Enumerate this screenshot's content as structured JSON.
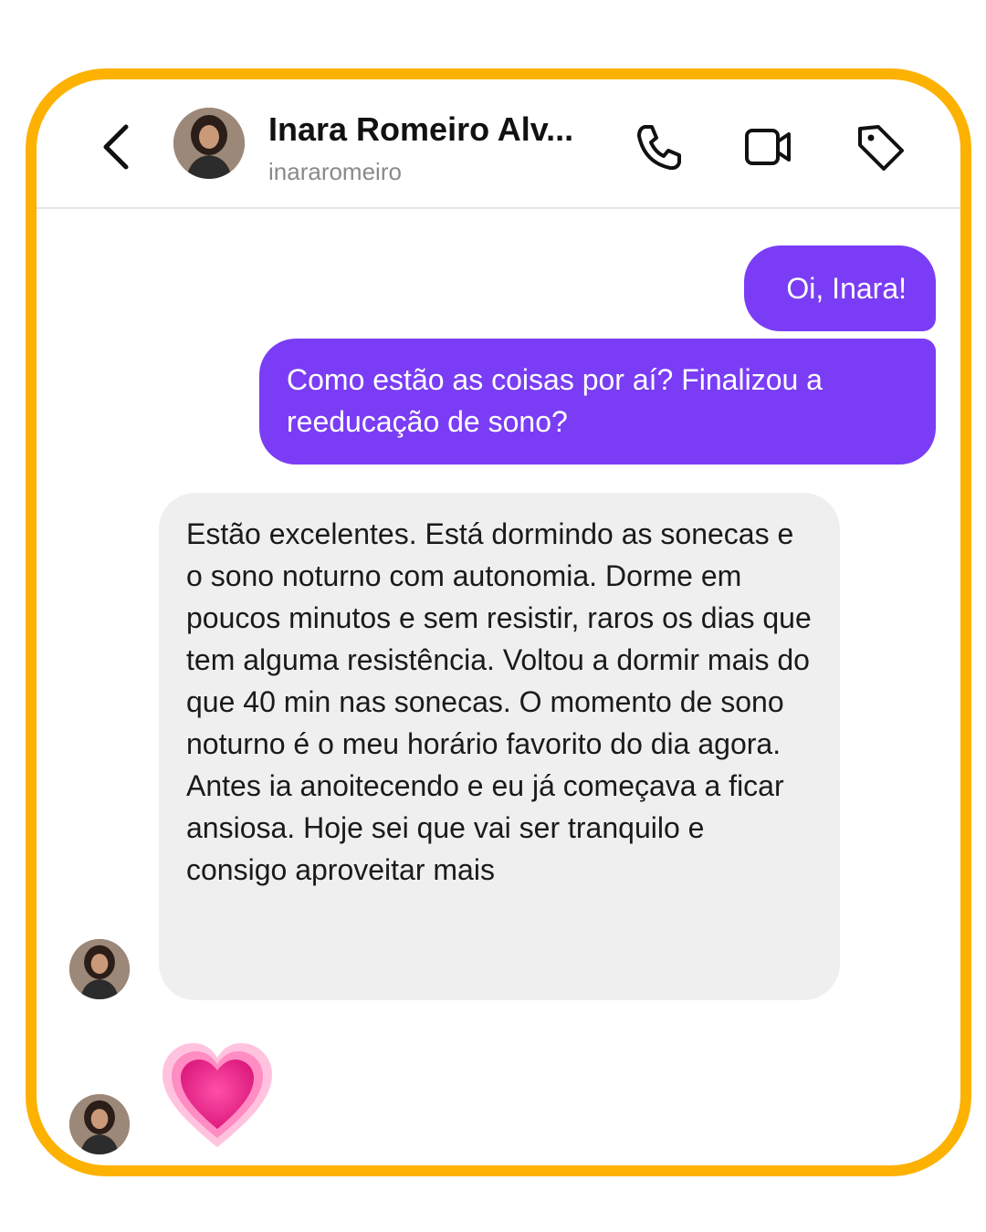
{
  "header": {
    "contact_name": "Inara Romeiro Alv...",
    "contact_handle": "inararomeiro",
    "icons": [
      "chevron-left-icon",
      "phone-icon",
      "video-icon",
      "tag-icon"
    ]
  },
  "messages": {
    "sent_1": "Oi, Inara!",
    "sent_2": "Como estão as coisas por aí? Finalizou a reeducação de sono?",
    "received_1": "Estão excelentes. Está dormindo as sonecas e o sono noturno com autonomia. Dorme em poucos minutos e sem resistir, raros os dias que tem alguma resistência. Voltou a dormir mais do que 40 min nas sonecas. O momento de sono noturno é o meu horário favorito do dia agora. Antes ia anoitecendo e eu já começava a ficar ansiosa. Hoje sei que vai ser tranquilo e consigo aproveitar mais",
    "reaction_emoji": "growing-heart-emoji"
  },
  "colors": {
    "frame_border": "#FDB100",
    "sent_bubble": "#7A3DF5",
    "received_bubble": "#EFEFEF"
  }
}
